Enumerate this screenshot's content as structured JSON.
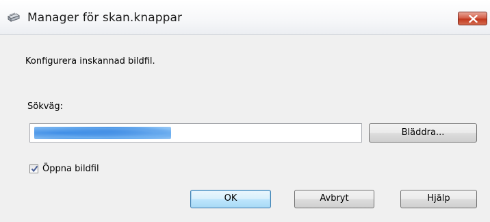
{
  "window": {
    "title": "Manager för skan.knappar"
  },
  "dialog": {
    "description": "Konfigurera inskannad bildfil.",
    "path_label": "Sökväg:",
    "path_value": "",
    "browse_label": "Bläddra...",
    "open_file_label": "Öppna bildfil",
    "open_file_checked": true
  },
  "buttons": {
    "ok": "OK",
    "cancel": "Avbryt",
    "help": "Hjälp"
  },
  "icons": {
    "app": "scanner-icon",
    "close": "close-icon",
    "check": "checkmark-icon"
  },
  "colors": {
    "close_button": "#c7432a",
    "default_button_border": "#3c7fb1",
    "dialog_background": "#f0f0f0"
  }
}
